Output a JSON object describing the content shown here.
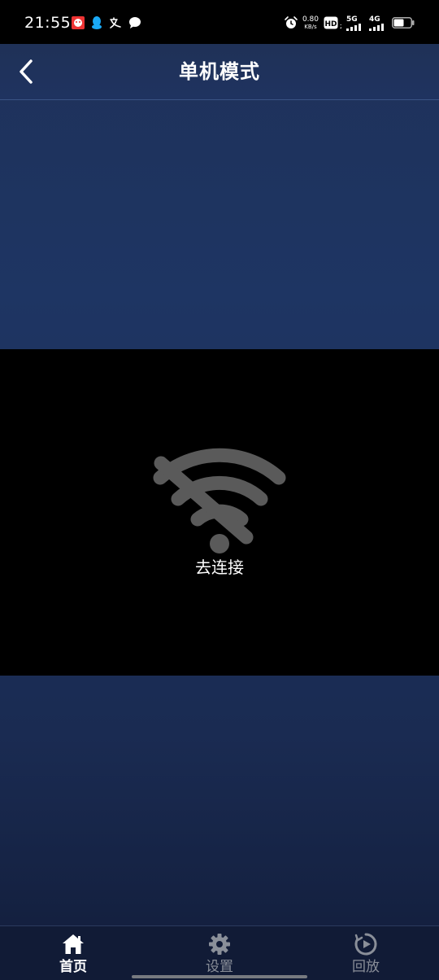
{
  "status_bar": {
    "time": "21:55",
    "left_icons": [
      "app-notification-icon",
      "qq-icon",
      "translate-icon",
      "message-icon"
    ],
    "net_speed_value": "0.80",
    "net_speed_unit": "KB/s",
    "hd_label": "HD",
    "sim1_label": "5G",
    "sim2_label": "4G",
    "battery_level": 0.6
  },
  "header": {
    "title": "单机模式",
    "back_icon": "chevron-left-icon"
  },
  "video": {
    "status_icon": "wifi-off-icon",
    "connect_label": "去连接"
  },
  "bottom_nav": {
    "items": [
      {
        "label": "首页",
        "icon": "home-icon",
        "active": true
      },
      {
        "label": "设置",
        "icon": "gear-icon",
        "active": false
      },
      {
        "label": "回放",
        "icon": "playback-icon",
        "active": false
      }
    ]
  },
  "colors": {
    "background_top": "#1f3159",
    "background_bottom": "#121d3a",
    "accent_active": "#ffffff",
    "inactive": "#8a8f99",
    "wifi_icon": "#5a5a5a"
  }
}
